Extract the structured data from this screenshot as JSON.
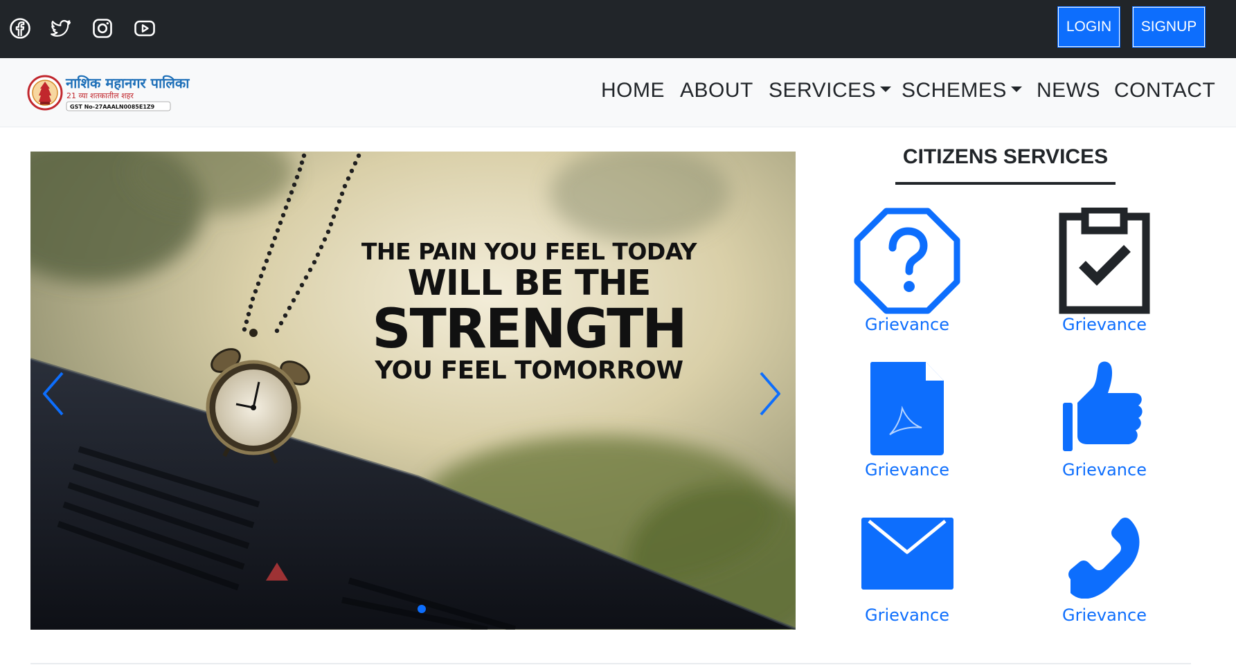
{
  "topbar": {
    "social_icons": [
      "facebook-icon",
      "twitter-icon",
      "instagram-icon",
      "youtube-icon"
    ],
    "login_label": "LOGIN",
    "signup_label": "SIGNUP"
  },
  "navbar": {
    "logo": {
      "title": "नाशिक महानगर पालिका",
      "subtitle": "21 व्या शतकातील शहर",
      "gst": "GST No-27AAALN0085E1Z9"
    },
    "items": [
      {
        "label": "HOME",
        "dropdown": false
      },
      {
        "label": "ABOUT",
        "dropdown": false
      },
      {
        "label": "SERVICES",
        "dropdown": true
      },
      {
        "label": "SCHEMES",
        "dropdown": true
      },
      {
        "label": "NEWS",
        "dropdown": false
      },
      {
        "label": "CONTACT",
        "dropdown": false
      }
    ]
  },
  "carousel": {
    "quote_lines": [
      "THE PAIN YOU FEEL TODAY",
      "WILL BE THE",
      "STRENGTH",
      "YOU FEEL TOMORROW"
    ],
    "prev_icon": "chevron-left-icon",
    "next_icon": "chevron-right-icon",
    "active_slide": 1,
    "slide_count": 1
  },
  "services": {
    "title": "CITIZENS SERVICES",
    "items": [
      {
        "label": "Grievance",
        "icon": "question-octagon-icon"
      },
      {
        "label": "Grievance",
        "icon": "clipboard-check-icon"
      },
      {
        "label": "Grievance",
        "icon": "pdf-file-icon"
      },
      {
        "label": "Grievance",
        "icon": "thumbs-up-icon"
      },
      {
        "label": "Grievance",
        "icon": "envelope-icon"
      },
      {
        "label": "Grievance",
        "icon": "telephone-icon"
      }
    ]
  },
  "colors": {
    "primary": "#0d6efd",
    "dark": "#212529",
    "nav_bg": "#f8f9fa"
  }
}
